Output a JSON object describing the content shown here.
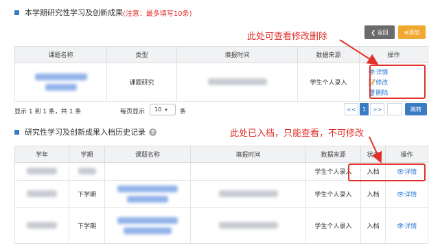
{
  "section1": {
    "title": "本学期研究性学习及创新成果",
    "note": "(注意：最多填写10条)",
    "back_label": "返回",
    "add_label": "添加",
    "back_icon": "chevron-left",
    "add_icon": "plus-circle",
    "columns": [
      "课题名称",
      "类型",
      "填报时间",
      "数据来源",
      "操作"
    ],
    "row": {
      "type": "课题研究",
      "source": "学生个人录入",
      "actions": {
        "detail": "👁详情",
        "edit": "📝修改",
        "delete": "🗑删除"
      }
    }
  },
  "pagination": {
    "summary": "显示 1 到 1 条，共 1 条",
    "per_page_label": "每页显示",
    "per_page_value": "10",
    "per_page_unit": "条",
    "prev": "<<",
    "current": "1",
    "next": ">>",
    "jump_label": "跳转"
  },
  "section2": {
    "title": "研究性学习及创新成果入档历史记录",
    "help_icon": "?",
    "columns": [
      "学年",
      "学期",
      "课题名称",
      "填报时间",
      "数据来源",
      "状态",
      "操作"
    ],
    "rows": [
      {
        "term": "",
        "source": "学生个人录入",
        "status": "入档",
        "action": "👁详情"
      },
      {
        "term": "下学期",
        "source": "学生个人录入",
        "status": "入档",
        "action": "👁详情"
      },
      {
        "term": "下学期",
        "source": "学生个人录入",
        "status": "入档",
        "action": "👁详情"
      }
    ]
  },
  "annotations": {
    "top": "此处可查看修改删除",
    "bottom": "此处已入档，只能查看，不可修改"
  },
  "colors": {
    "accent": "#3a7cc4",
    "annotation": "#e0312a",
    "add_button": "#f0a830"
  }
}
